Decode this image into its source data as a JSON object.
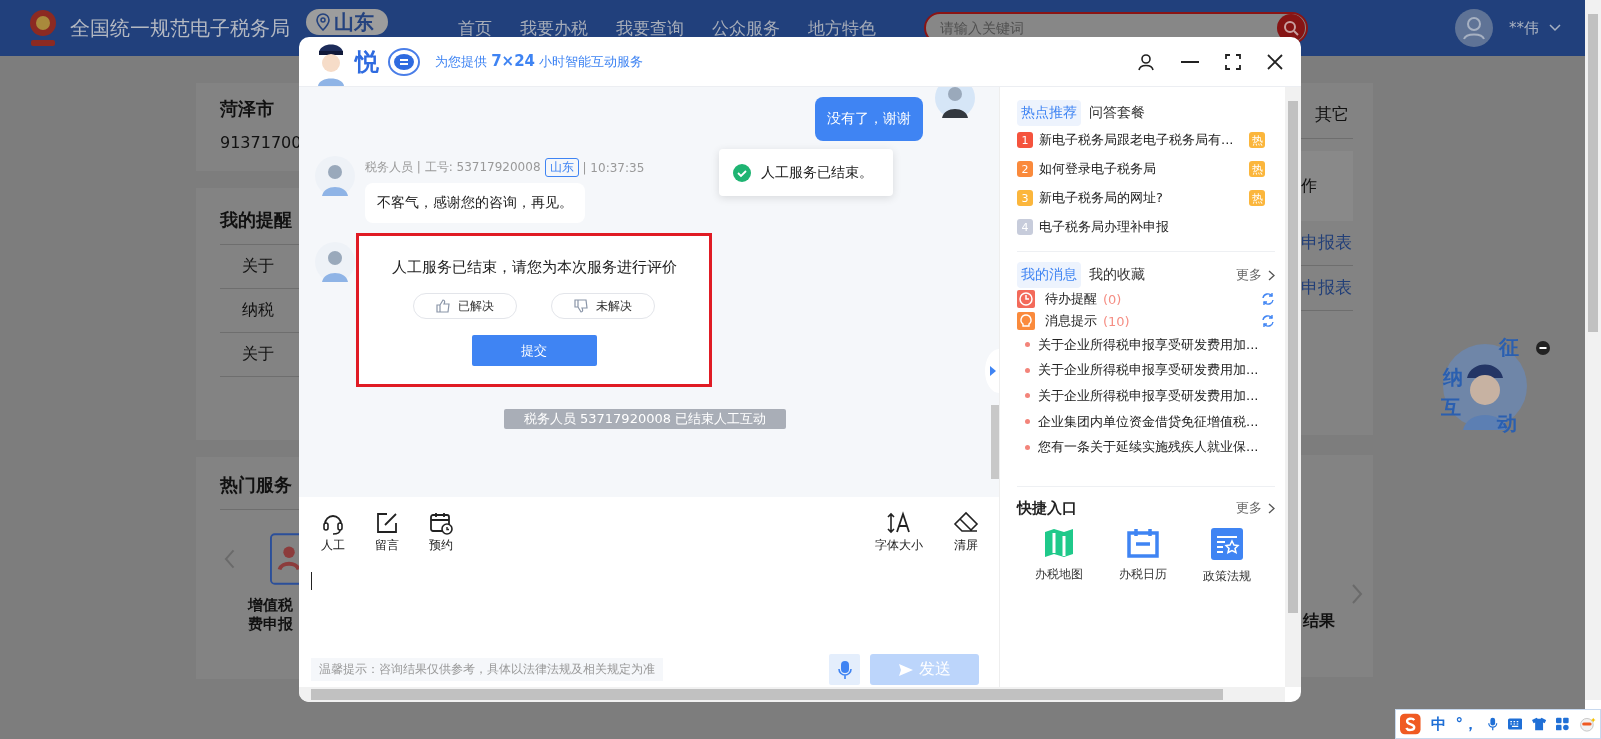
{
  "page": {
    "site_title": "全国统一规范电子税务局",
    "region": "山东",
    "nav": [
      "首页",
      "我要办税",
      "我要查询",
      "公众服务",
      "地方特色"
    ],
    "search": {
      "placeholder": "请输入关键词"
    },
    "user": "**伟"
  },
  "background": {
    "company": "菏泽市",
    "tax_id": "91371700",
    "reminders": {
      "title": "我的提醒",
      "items": [
        "关于",
        "纳税",
        "关于"
      ]
    },
    "hot_services": {
      "title": "热门服务",
      "service_lines": [
        "增值税",
        "费申报"
      ]
    },
    "right_fragments": {
      "tab": "其它",
      "column": "作",
      "links": [
        "申报表",
        "申报表"
      ],
      "service": "结果"
    }
  },
  "assistant": {
    "name": "悦",
    "tagline": "为您提供 **7×24** 小时智能互动服务"
  },
  "chat": {
    "messages": [
      {
        "kind": "user",
        "text": "没有了，谢谢"
      },
      {
        "kind": "agent",
        "sender": "税务人员 | 工号: 53717920008",
        "region": "山东",
        "time": "| 10:37:35",
        "text": "不客气，感谢您的咨询，再见。"
      },
      {
        "kind": "rating",
        "title": "人工服务已结束，请您为本次服务进行评价",
        "options": [
          {
            "label": "已解决",
            "kind": "up",
            "selected": false
          },
          {
            "label": "未解决",
            "kind": "down",
            "selected": false
          }
        ],
        "submit": "提交",
        "highlighted": true
      },
      {
        "kind": "notice",
        "text": "税务人员 53717920008 已结束人工互动"
      }
    ],
    "toast": "人工服务已结束。"
  },
  "toolbar": {
    "left": [
      {
        "kind": "agent",
        "label": "人工"
      },
      {
        "kind": "note",
        "label": "留言"
      },
      {
        "kind": "schedule",
        "label": "预约"
      }
    ],
    "right": [
      {
        "kind": "font",
        "label": "字体大小"
      },
      {
        "kind": "clear",
        "label": "清屏"
      }
    ]
  },
  "composer": {
    "hint": "温馨提示：咨询结果仅供参考，具体以法律法规及相关规定为准",
    "send": "发送",
    "send_disabled": true
  },
  "hot": {
    "tabs": [
      {
        "label": "热点推荐",
        "selected": true
      },
      {
        "label": "问答套餐",
        "selected": false
      }
    ],
    "items": [
      {
        "rank": "1",
        "color": "#f5533d",
        "text": "新电子税务局跟老电子税务局有...",
        "badge": "热"
      },
      {
        "rank": "2",
        "color": "#fa8a3c",
        "text": "如何登录电子税务局",
        "badge": "热"
      },
      {
        "rank": "3",
        "color": "#fbb63c",
        "text": "新电子税务局的网址?",
        "badge": "热"
      },
      {
        "rank": "4",
        "color": "#c7ccdb",
        "text": "电子税务局办理补申报"
      }
    ]
  },
  "messages": {
    "tabs": [
      {
        "label": "我的消息",
        "selected": true
      },
      {
        "label": "我的收藏",
        "selected": false
      }
    ],
    "more": "更多",
    "counters": [
      {
        "kind": "todo",
        "label": "待办提醒",
        "count": "(0)"
      },
      {
        "kind": "notice",
        "label": "消息提示",
        "count": "(10)"
      }
    ],
    "items": [
      "关于企业所得税申报享受研发费用加...",
      "关于企业所得税申报享受研发费用加...",
      "关于企业所得税申报享受研发费用加...",
      "企业集团内单位资金借贷免征增值税...",
      "您有一条关于延续实施残疾人就业保..."
    ]
  },
  "shortcuts": {
    "title": "快捷入口",
    "more": "更多",
    "items": [
      {
        "kind": "map",
        "label": "办税地图"
      },
      {
        "kind": "calendar",
        "label": "办税日历"
      },
      {
        "kind": "policy",
        "label": "政策法规"
      }
    ]
  },
  "widget": {
    "chars": [
      "征",
      "纳",
      "互",
      "动"
    ]
  },
  "ime": {
    "mode": "中",
    "punct": "°，"
  }
}
